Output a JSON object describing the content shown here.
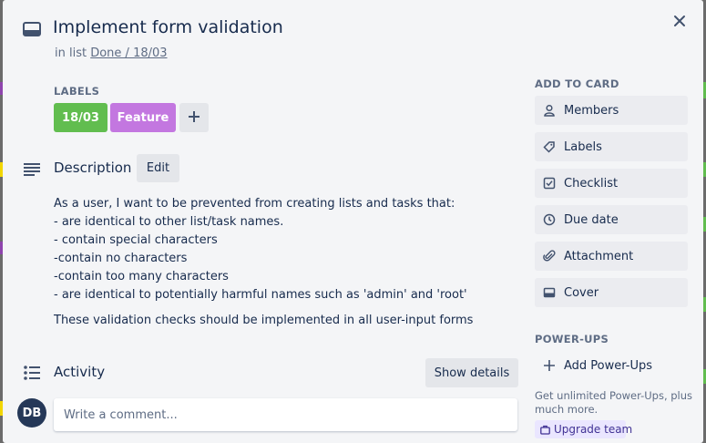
{
  "card": {
    "title": "Implement form validation",
    "list_prefix": "in list",
    "list_name": "Done / 18/03"
  },
  "labels": {
    "heading": "LABELS",
    "items": [
      {
        "text": "18/03",
        "color": "#61bd4f"
      },
      {
        "text": "Feature",
        "color": "#c377e0"
      }
    ]
  },
  "description": {
    "heading": "Description",
    "edit_label": "Edit",
    "lines": [
      "As a user, I want to be prevented from creating lists and tasks that:",
      "- are identical to other list/task names.",
      "- contain special characters",
      "-contain no characters",
      "-contain too many characters",
      "- are identical to potentially harmful names such as 'admin' and 'root'"
    ],
    "closing": "These validation checks should be implemented in all user-input forms"
  },
  "activity": {
    "heading": "Activity",
    "details_label": "Show details",
    "avatar_initials": "DB",
    "comment_placeholder": "Write a comment..."
  },
  "sidebar": {
    "add_heading": "ADD TO CARD",
    "items": [
      {
        "label": "Members",
        "icon": "person-icon"
      },
      {
        "label": "Labels",
        "icon": "tag-icon"
      },
      {
        "label": "Checklist",
        "icon": "checklist-icon"
      },
      {
        "label": "Due date",
        "icon": "clock-icon"
      },
      {
        "label": "Attachment",
        "icon": "paperclip-icon"
      },
      {
        "label": "Cover",
        "icon": "cover-icon"
      }
    ],
    "powerups_heading": "POWER-UPS",
    "add_powerups_label": "Add Power-Ups",
    "powerups_note": "Get unlimited Power-Ups, plus much more.",
    "upgrade_label": "Upgrade team"
  },
  "colors": {
    "modal_bg": "#f4f5f7",
    "button_bg": "#ebecf0",
    "label_green": "#61bd4f",
    "label_purple": "#c377e0",
    "avatar_bg": "#253858",
    "upgrade_bg": "#eae6ff"
  }
}
